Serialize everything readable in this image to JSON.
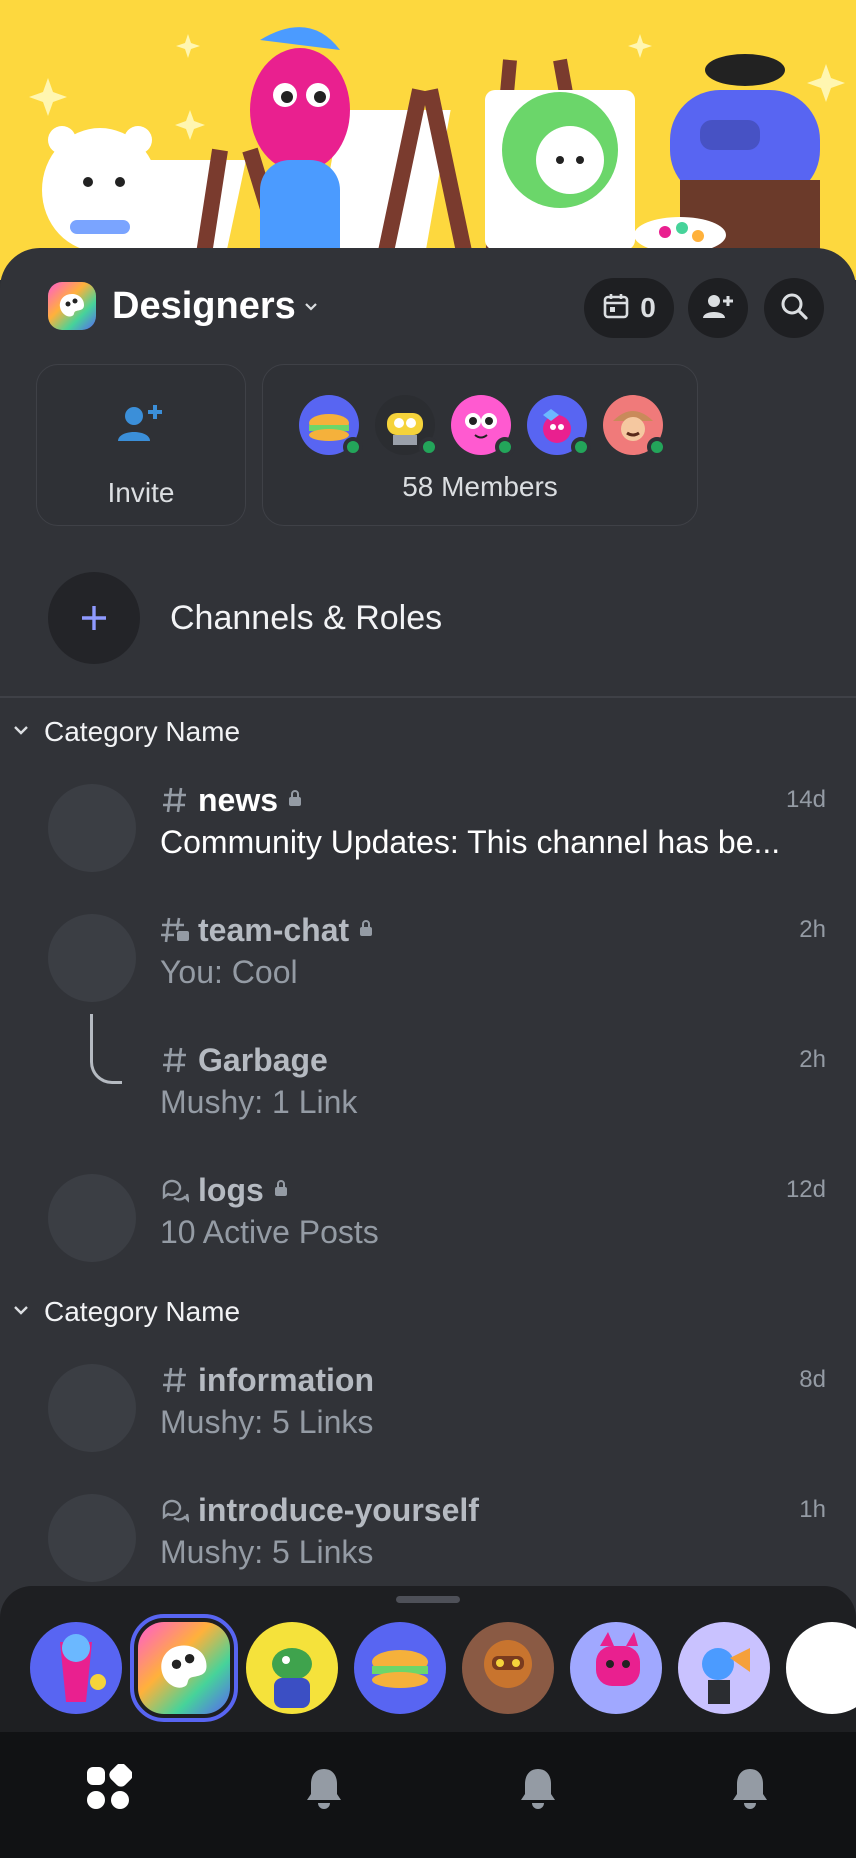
{
  "server": {
    "name": "Designers",
    "events_count": "0"
  },
  "invite_card": {
    "label": "Invite"
  },
  "members_card": {
    "label": "58 Members"
  },
  "channels_roles": {
    "label": "Channels & Roles"
  },
  "categories": [
    {
      "name": "Category Name",
      "channels": [
        {
          "name": "news",
          "subtitle": "Community Updates: This channel has be...",
          "time": "14d"
        },
        {
          "name": "team-chat",
          "subtitle": "You: Cool",
          "time": "2h"
        },
        {
          "name": "Garbage",
          "subtitle": "Mushy: 1 Link",
          "time": "2h"
        },
        {
          "name": "logs",
          "subtitle": "10 Active Posts",
          "time": "12d"
        }
      ]
    },
    {
      "name": "Category Name",
      "channels": [
        {
          "name": "information",
          "subtitle": "Mushy: 5 Links",
          "time": "8d"
        },
        {
          "name": "introduce-yourself",
          "subtitle": "Mushy: 5 Links",
          "time": "1h"
        }
      ]
    }
  ],
  "colors": {
    "accent": "#5865f2",
    "online": "#23a55a",
    "banner": "#fdd83e",
    "background": "#313338"
  }
}
